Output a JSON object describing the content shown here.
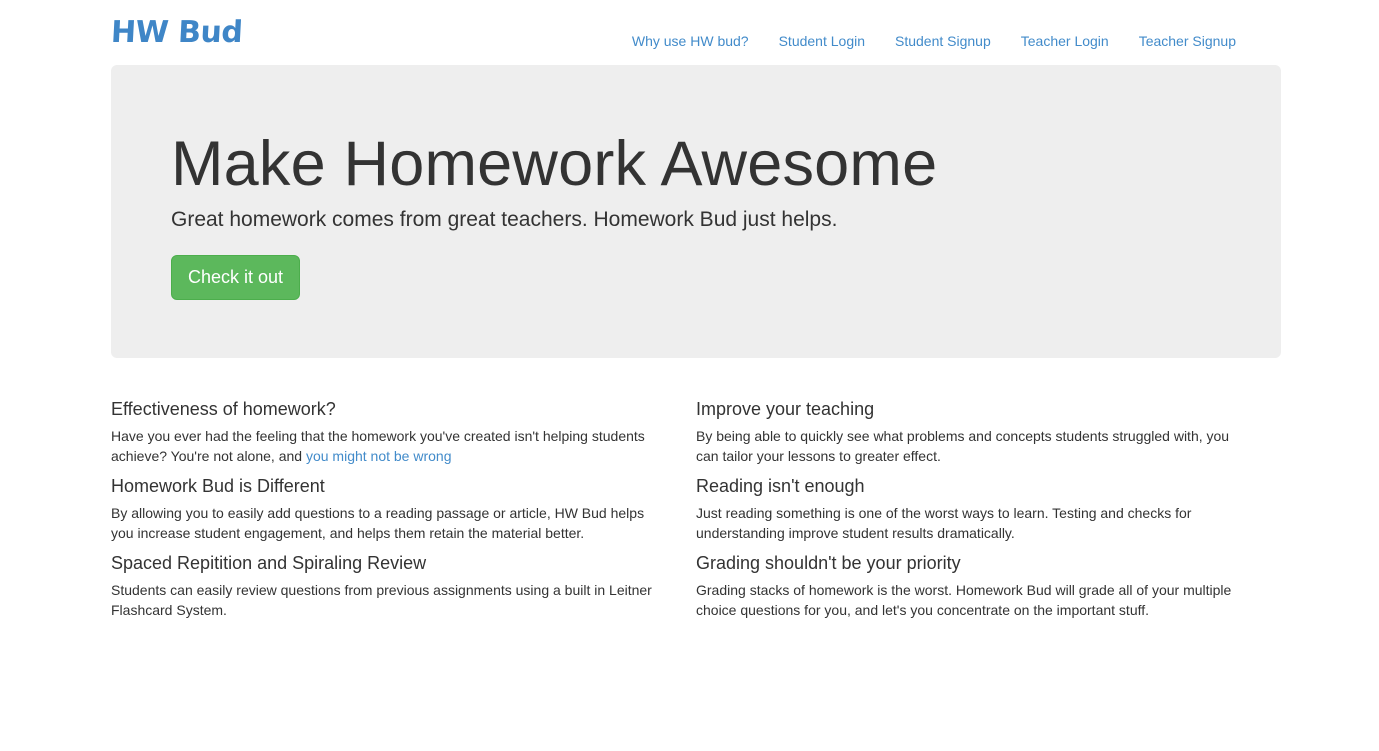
{
  "brand": "HW Bud",
  "nav": {
    "items": [
      {
        "label": "Why use HW bud?"
      },
      {
        "label": "Student Login"
      },
      {
        "label": "Student Signup"
      },
      {
        "label": "Teacher Login"
      },
      {
        "label": "Teacher Signup"
      }
    ]
  },
  "hero": {
    "title": "Make Homework Awesome",
    "lead": "Great homework comes from great teachers. Homework Bud just helps.",
    "button": "Check it out"
  },
  "features": {
    "left": [
      {
        "title": "Effectiveness of homework?",
        "text": "Have you ever had the feeling that the homework you've created isn't helping students achieve? You're not alone, and ",
        "link": "you might not be wrong"
      },
      {
        "title": "Homework Bud is Different",
        "text": "By allowing you to easily add questions to a reading passage or article, HW Bud helps you increase student engagement, and helps them retain the material better."
      },
      {
        "title": "Spaced Repitition and Spiraling Review",
        "text": "Students can easily review questions from previous assignments using a built in Leitner Flashcard System."
      }
    ],
    "right": [
      {
        "title": "Improve your teaching",
        "text": "By being able to quickly see what problems and concepts students struggled with, you can tailor your lessons to greater effect."
      },
      {
        "title": "Reading isn't enough",
        "text": "Just reading something is one of the worst ways to learn. Testing and checks for understanding improve student results dramatically."
      },
      {
        "title": "Grading shouldn't be your priority",
        "text": "Grading stacks of homework is the worst. Homework Bud will grade all of your multiple choice questions for you, and let's you concentrate on the important stuff."
      }
    ]
  },
  "colors": {
    "brand": "#3f86c7",
    "link": "#428bca",
    "button": "#5cb85c",
    "jumbotron_bg": "#eeeeee"
  }
}
